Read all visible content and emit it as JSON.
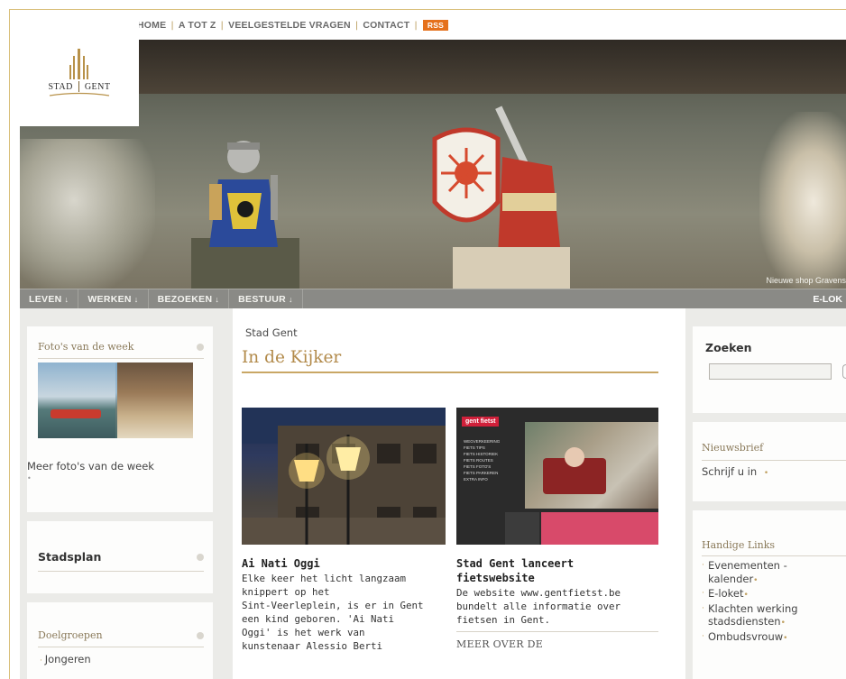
{
  "topnav": {
    "links": [
      "HOME",
      "A TOT Z",
      "VEELGESTELDE VRAGEN",
      "CONTACT"
    ],
    "rss": "RSS"
  },
  "logo": {
    "left": "STAD",
    "right": "GENT"
  },
  "hero": {
    "caption": "Nieuwe shop Gravens"
  },
  "mainmenu": {
    "items": [
      "LEVEN",
      "WERKEN",
      "BEZOEKEN",
      "BESTUUR"
    ],
    "arrow": "↓",
    "eloket": "E-LOK"
  },
  "left": {
    "photos_title": "Foto's van de week",
    "photos_link": "Meer foto's van de week",
    "photos_link_bullet": "•",
    "stadsplan": "Stadsplan",
    "doelgroepen": "Doelgroepen",
    "doelgroepen_first": "Jongeren"
  },
  "middle": {
    "breadcrumb": "Stad Gent",
    "heading": "In de Kijker",
    "articles": [
      {
        "title": "Ai Nati Oggi",
        "body": [
          "Elke keer het licht langzaam",
          "knippert op het",
          "Sint-Veerleplein, is er in Gent",
          "een kind geboren. 'Ai Nati",
          "Oggi' is het werk van",
          "kunstenaar Alessio Berti"
        ]
      },
      {
        "title": "Stad Gent lanceert",
        "title2": "fietswebsite",
        "body": [
          "De website www.gentfietst.be",
          "bundelt alle informatie over",
          "fietsen in Gent."
        ],
        "more": "MEER OVER DE"
      }
    ],
    "fiets_tag": "gent fietst",
    "fiets_menu": [
      "WEGVERKEERING",
      "FIETS TIPS",
      "FIETS HISTORIEK",
      "FIETS ROUTES",
      "FIETS FOTO'S",
      "FIETS PARKEREN",
      "EXTRA INFO"
    ]
  },
  "right": {
    "zoeken": "Zoeken",
    "search_placeholder": "",
    "nieuwsbrief": "Nieuwsbrief",
    "schrijf": "Schrijf u in",
    "handige": "Handige Links",
    "links": [
      [
        "Evenementen -",
        "kalender"
      ],
      [
        "E-loket"
      ],
      [
        "Klachten werking",
        "stadsdiensten"
      ],
      [
        "Ombudsvrouw"
      ]
    ],
    "link_bullet": "•"
  }
}
